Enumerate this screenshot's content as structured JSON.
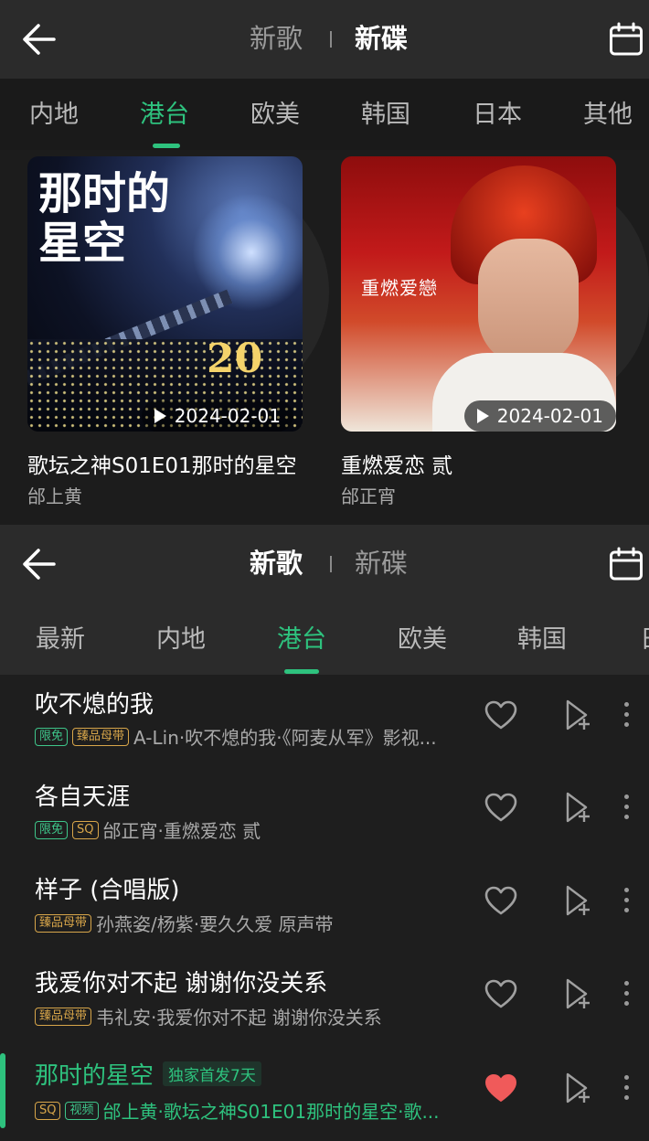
{
  "top_header": {
    "tabs": [
      "新歌",
      "新碟"
    ],
    "active_tab": "新碟"
  },
  "top_categories": [
    "内地",
    "港台",
    "欧美",
    "韩国",
    "日本",
    "其他"
  ],
  "top_active_category": "港台",
  "albums": [
    {
      "title": "歌坛之神S01E01那时的星空",
      "artist": "邰上黄",
      "date": "2024-02-01",
      "cover_text": "那时的星空",
      "cover_small": "20"
    },
    {
      "title": "重燃爱恋 贰",
      "artist": "邰正宵",
      "date": "2024-02-01",
      "cover_text": "重燃爱戀"
    }
  ],
  "bottom_header": {
    "tabs": [
      "新歌",
      "新碟"
    ],
    "active_tab": "新歌"
  },
  "bottom_categories": [
    "最新",
    "内地",
    "港台",
    "欧美",
    "韩国",
    "日"
  ],
  "bottom_active_category": "港台",
  "songs": [
    {
      "title": "吹不熄的我",
      "badges": [
        "限免",
        "臻品母带"
      ],
      "subtitle": "A-Lin·吹不熄的我·《阿麦从军》影视...",
      "liked": false
    },
    {
      "title": "各自天涯",
      "badges": [
        "限免",
        "SQ"
      ],
      "subtitle": "邰正宵·重燃爱恋 贰",
      "liked": false
    },
    {
      "title": "样子 (合唱版)",
      "badges": [
        "臻品母带"
      ],
      "subtitle": "孙燕姿/杨紫·要久久爱 原声带",
      "liked": false
    },
    {
      "title": "我爱你对不起 谢谢你没关系",
      "badges": [
        "臻品母带"
      ],
      "subtitle": "韦礼安·我爱你对不起 谢谢你没关系",
      "liked": false
    },
    {
      "title": "那时的星空",
      "tag": "独家首发7天",
      "badges": [
        "SQ",
        "视频"
      ],
      "subtitle": "邰上黄·歌坛之神S01E01那时的星空·歌...",
      "liked": true,
      "playing": true
    }
  ],
  "colors": {
    "accent": "#2ec27e",
    "like_active": "#f05a5a",
    "badge_gold": "#d8a64a",
    "badge_green": "#3ec68a"
  }
}
